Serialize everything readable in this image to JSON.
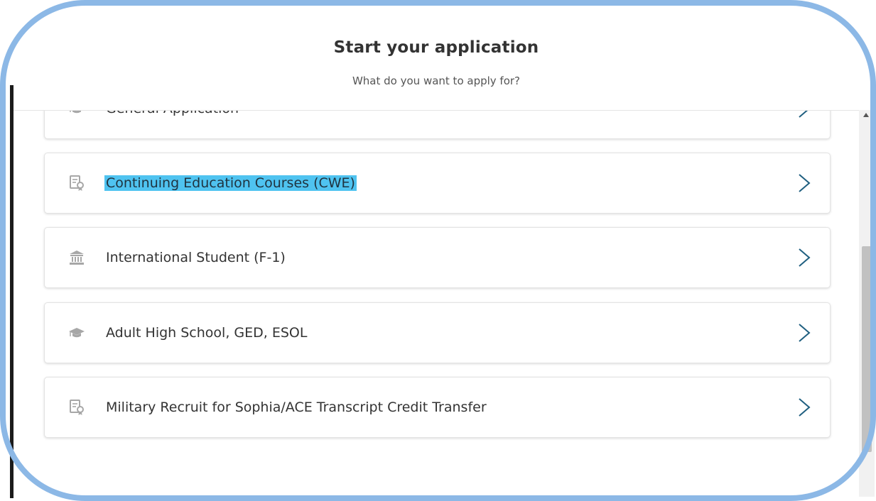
{
  "header": {
    "title": "Start your application",
    "subtitle": "What do you want to apply for?"
  },
  "options": [
    {
      "label": "General Application",
      "icon": "graduation-cap-icon",
      "highlighted": false
    },
    {
      "label": "Continuing Education Courses (CWE)",
      "icon": "certificate-icon",
      "highlighted": true
    },
    {
      "label": "International Student (F-1)",
      "icon": "institution-icon",
      "highlighted": false
    },
    {
      "label": "Adult High School, GED, ESOL",
      "icon": "graduation-cap-icon",
      "highlighted": false
    },
    {
      "label": "Military Recruit for Sophia/ACE Transcript Credit Transfer",
      "icon": "certificate-icon",
      "highlighted": false
    }
  ],
  "colors": {
    "highlight": "#4fc3f0",
    "chevron": "#1f5f80",
    "icon": "#a7a7a7",
    "frame": "#8cb8e6"
  }
}
